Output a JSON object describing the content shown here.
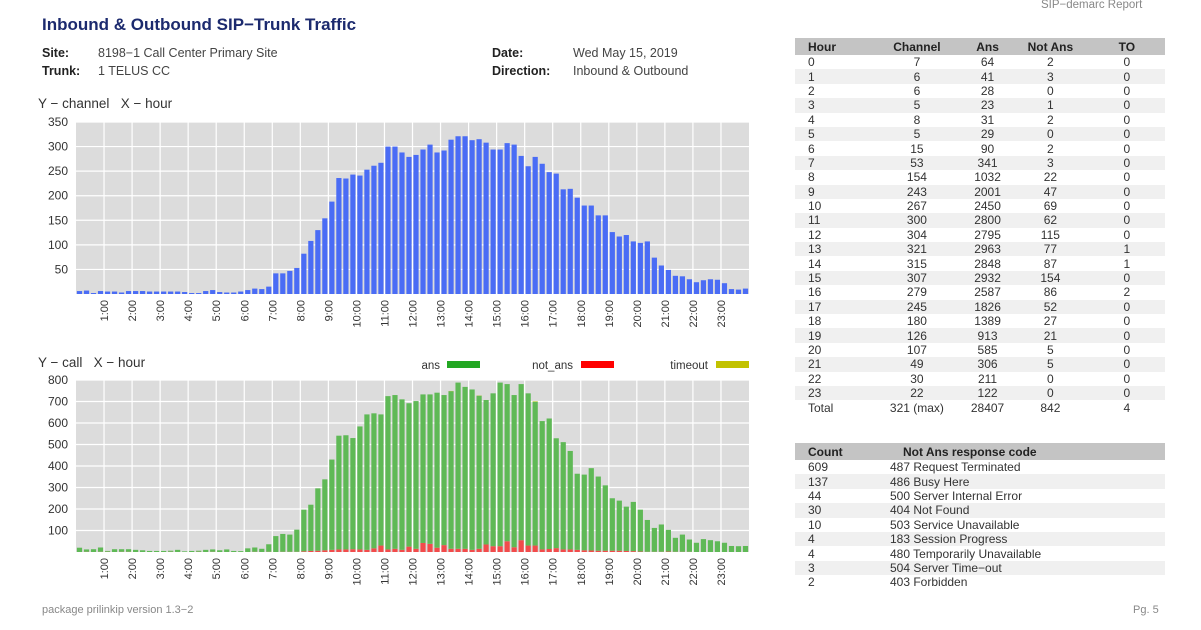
{
  "header": {
    "report_name": "SIP−demarc Report",
    "title": "Inbound & Outbound SIP−Trunk Traffic",
    "site_label": "Site:",
    "site_value": "8198−1 Call Center Primary Site",
    "trunk_label": "Trunk:",
    "trunk_value": "1 TELUS CC",
    "date_label": "Date:",
    "date_value": "Wed May 15, 2019",
    "direction_label": "Direction:",
    "direction_value": "Inbound & Outbound"
  },
  "footer": {
    "package": "package prilinkip version 1.3−2",
    "page": "Pg. 5"
  },
  "chart_data": [
    {
      "type": "bar",
      "axis_title": "Y − channel   X − hour",
      "x_tick_labels": [
        "1:00",
        "2:00",
        "3:00",
        "4:00",
        "5:00",
        "6:00",
        "7:00",
        "8:00",
        "9:00",
        "10:00",
        "11:00",
        "12:00",
        "13:00",
        "14:00",
        "15:00",
        "16:00",
        "17:00",
        "18:00",
        "19:00",
        "20:00",
        "21:00",
        "22:00",
        "23:00"
      ],
      "x_bins_per_hour": 4,
      "y_ticks": [
        50,
        100,
        150,
        200,
        250,
        300,
        350
      ],
      "ylim": [
        0,
        350
      ],
      "grid": true,
      "color": "#4a6cf5",
      "values": [
        6,
        7,
        2,
        6,
        5,
        5,
        3,
        6,
        6,
        6,
        5,
        5,
        5,
        5,
        5,
        4,
        2,
        2,
        6,
        8,
        4,
        3,
        3,
        5,
        8,
        11,
        10,
        15,
        42,
        42,
        47,
        53,
        82,
        108,
        130,
        154,
        188,
        236,
        235,
        243,
        241,
        253,
        261,
        267,
        300,
        300,
        288,
        279,
        283,
        294,
        304,
        288,
        292,
        314,
        321,
        321,
        313,
        315,
        308,
        294,
        294,
        307,
        304,
        281,
        260,
        279,
        265,
        248,
        245,
        213,
        214,
        196,
        180,
        180,
        160,
        160,
        126,
        117,
        120,
        107,
        104,
        107,
        74,
        58,
        49,
        37,
        36,
        30,
        24,
        28,
        30,
        29,
        22,
        10,
        9,
        11
      ]
    },
    {
      "type": "bar",
      "stacked": true,
      "axis_title": "Y − call   X − hour",
      "x_tick_labels": [
        "1:00",
        "2:00",
        "3:00",
        "4:00",
        "5:00",
        "6:00",
        "7:00",
        "8:00",
        "9:00",
        "10:00",
        "11:00",
        "12:00",
        "13:00",
        "14:00",
        "15:00",
        "16:00",
        "17:00",
        "18:00",
        "19:00",
        "20:00",
        "21:00",
        "22:00",
        "23:00"
      ],
      "x_bins_per_hour": 4,
      "y_ticks": [
        100,
        200,
        300,
        400,
        500,
        600,
        700,
        800
      ],
      "ylim": [
        0,
        800
      ],
      "grid": true,
      "legend_position": "top-right",
      "series": [
        {
          "name": "not_ans",
          "legend_color": "#ff0000",
          "color": "#f24b4b",
          "values": [
            0,
            1,
            0,
            1,
            1,
            0,
            1,
            1,
            0,
            0,
            0,
            0,
            0,
            1,
            0,
            0,
            0,
            1,
            0,
            1,
            0,
            0,
            0,
            0,
            0,
            1,
            0,
            1,
            0,
            1,
            1,
            1,
            3,
            5,
            6,
            8,
            10,
            12,
            12,
            13,
            12,
            10,
            17,
            30,
            12,
            15,
            10,
            25,
            15,
            42,
            38,
            20,
            32,
            15,
            15,
            15,
            10,
            15,
            35,
            27,
            27,
            50,
            22,
            55,
            30,
            30,
            12,
            14,
            18,
            12,
            12,
            10,
            8,
            7,
            6,
            6,
            6,
            6,
            5,
            4,
            2,
            1,
            1,
            1,
            2,
            1,
            1,
            1,
            0,
            0,
            0,
            0,
            0,
            0,
            0,
            0
          ]
        },
        {
          "name": "ans",
          "legend_color": "#22a722",
          "color": "#5fb956",
          "values": [
            20,
            11,
            13,
            20,
            4,
            13,
            12,
            12,
            10,
            8,
            5,
            5,
            5,
            5,
            10,
            3,
            5,
            5,
            10,
            11,
            8,
            12,
            5,
            4,
            17,
            20,
            15,
            35,
            74,
            83,
            80,
            103,
            194,
            215,
            290,
            330,
            420,
            529,
            531,
            517,
            572,
            630,
            628,
            610,
            713,
            715,
            700,
            667,
            687,
            691,
            695,
            721,
            698,
            733,
            773,
            753,
            746,
            712,
            672,
            711,
            761,
            731,
            708,
            726,
            708,
            669,
            597,
            607,
            511,
            499,
            458,
            354,
            352,
            383,
            345,
            304,
            244,
            233,
            206,
            229,
            195,
            148,
            111,
            127,
            101,
            65,
            80,
            57,
            43,
            60,
            55,
            50,
            43,
            28,
            27,
            28
          ]
        },
        {
          "name": "timeout",
          "legend_color": "#c2c200",
          "color": "#c2c200",
          "values": [
            0,
            0,
            0,
            0,
            0,
            0,
            0,
            0,
            0,
            0,
            0,
            0,
            0,
            0,
            0,
            0,
            0,
            0,
            0,
            0,
            0,
            0,
            0,
            0,
            0,
            0,
            0,
            0,
            0,
            0,
            0,
            0,
            0,
            0,
            0,
            0,
            0,
            0,
            0,
            0,
            0,
            0,
            0,
            0,
            0,
            0,
            0,
            0,
            0,
            0,
            0,
            0,
            0,
            1,
            0,
            0,
            0,
            1,
            0,
            0,
            0,
            0,
            0,
            0,
            0,
            2,
            0,
            0,
            0,
            0,
            0,
            0,
            0,
            0,
            0,
            0,
            0,
            0,
            0,
            0,
            0,
            0,
            0,
            0,
            0,
            0,
            0,
            0,
            0,
            0,
            0,
            0,
            0,
            0,
            0,
            0
          ]
        }
      ]
    }
  ],
  "hourly_table": {
    "headers": [
      "Hour",
      "Channel",
      "Ans",
      "Not Ans",
      "TO"
    ],
    "rows": [
      [
        "0",
        "7",
        "64",
        "2",
        "0"
      ],
      [
        "1",
        "6",
        "41",
        "3",
        "0"
      ],
      [
        "2",
        "6",
        "28",
        "0",
        "0"
      ],
      [
        "3",
        "5",
        "23",
        "1",
        "0"
      ],
      [
        "4",
        "8",
        "31",
        "2",
        "0"
      ],
      [
        "5",
        "5",
        "29",
        "0",
        "0"
      ],
      [
        "6",
        "15",
        "90",
        "2",
        "0"
      ],
      [
        "7",
        "53",
        "341",
        "3",
        "0"
      ],
      [
        "8",
        "154",
        "1032",
        "22",
        "0"
      ],
      [
        "9",
        "243",
        "2001",
        "47",
        "0"
      ],
      [
        "10",
        "267",
        "2450",
        "69",
        "0"
      ],
      [
        "11",
        "300",
        "2800",
        "62",
        "0"
      ],
      [
        "12",
        "304",
        "2795",
        "115",
        "0"
      ],
      [
        "13",
        "321",
        "2963",
        "77",
        "1"
      ],
      [
        "14",
        "315",
        "2848",
        "87",
        "1"
      ],
      [
        "15",
        "307",
        "2932",
        "154",
        "0"
      ],
      [
        "16",
        "279",
        "2587",
        "86",
        "2"
      ],
      [
        "17",
        "245",
        "1826",
        "52",
        "0"
      ],
      [
        "18",
        "180",
        "1389",
        "27",
        "0"
      ],
      [
        "19",
        "126",
        "913",
        "21",
        "0"
      ],
      [
        "20",
        "107",
        "585",
        "5",
        "0"
      ],
      [
        "21",
        "49",
        "306",
        "5",
        "0"
      ],
      [
        "22",
        "30",
        "211",
        "0",
        "0"
      ],
      [
        "23",
        "22",
        "122",
        "0",
        "0"
      ]
    ],
    "total": [
      "Total",
      "321 (max)",
      "28407",
      "842",
      "4"
    ]
  },
  "response_table": {
    "headers": [
      "Count",
      "Not Ans response code"
    ],
    "rows": [
      [
        "609",
        "487 Request Terminated"
      ],
      [
        "137",
        "486 Busy Here"
      ],
      [
        "44",
        "500 Server Internal Error"
      ],
      [
        "30",
        "404 Not Found"
      ],
      [
        "10",
        "503 Service Unavailable"
      ],
      [
        "4",
        "183 Session Progress"
      ],
      [
        "4",
        "480 Temporarily Unavailable"
      ],
      [
        "3",
        "504 Server Time−out"
      ],
      [
        "2",
        "403 Forbidden"
      ]
    ]
  }
}
